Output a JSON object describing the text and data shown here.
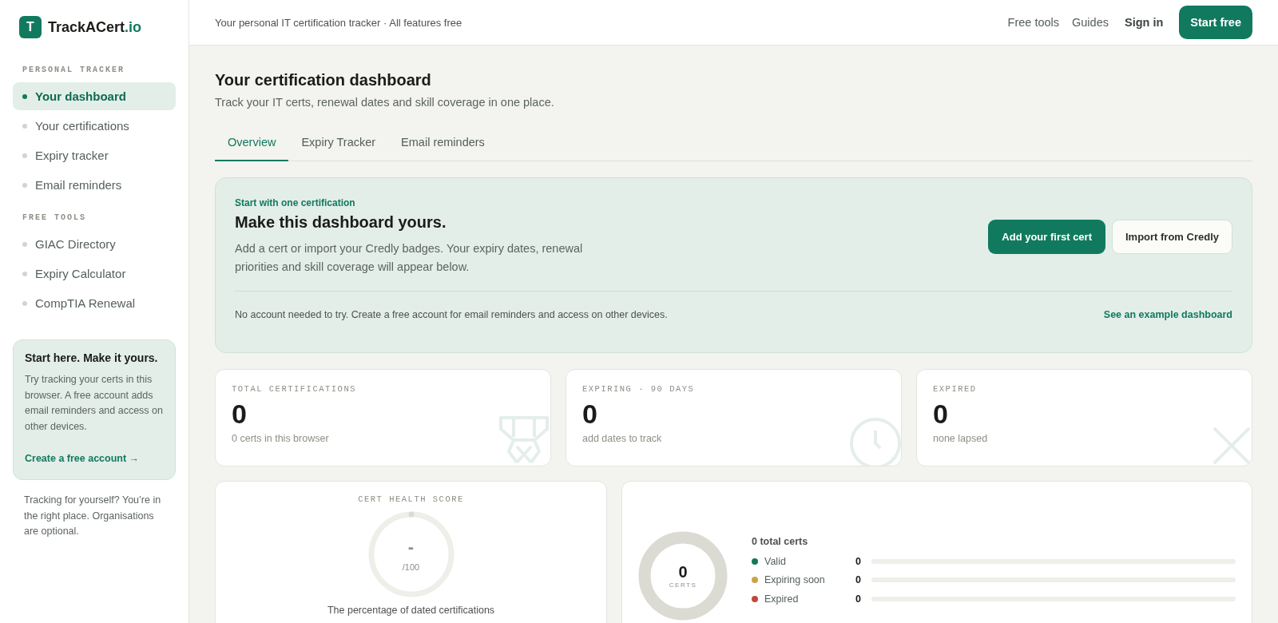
{
  "brand": {
    "logo_letter": "T",
    "name": "TrackACert",
    "suffix": ".io"
  },
  "sidebar": {
    "sections": [
      {
        "heading": "PERSONAL TRACKER",
        "items": [
          {
            "label": "Your dashboard",
            "selected": true
          },
          {
            "label": "Your certifications",
            "selected": false
          },
          {
            "label": "Expiry tracker",
            "selected": false
          },
          {
            "label": "Email reminders",
            "selected": false
          }
        ]
      },
      {
        "heading": "FREE TOOLS",
        "items": [
          {
            "label": "GIAC Directory",
            "selected": false
          },
          {
            "label": "Expiry Calculator",
            "selected": false
          },
          {
            "label": "CompTIA Renewal",
            "selected": false
          }
        ]
      }
    ],
    "promo": {
      "title": "Start here. Make it yours.",
      "text": "Try tracking your certs in this browser. A free account adds email reminders and access on other devices.",
      "link": "Create a free account →"
    },
    "note": "Tracking for yourself? You’re in the right place. Organisations are optional."
  },
  "topbar": {
    "tagline": "Your personal IT certification tracker · All features free",
    "links": [
      "Free tools",
      "Guides"
    ],
    "sign_in": "Sign in",
    "cta": "Start free"
  },
  "page": {
    "title": "Your certification dashboard",
    "subtitle": "Track your IT certs, renewal dates and skill coverage in one place."
  },
  "tabs": [
    {
      "label": "Overview",
      "selected": true
    },
    {
      "label": "Expiry Tracker",
      "selected": false
    },
    {
      "label": "Email reminders",
      "selected": false
    }
  ],
  "hero": {
    "eyebrow": "Start with one certification",
    "title": "Make this dashboard yours.",
    "text": "Add a cert or import your Credly badges. Your expiry dates, renewal priorities and skill coverage will appear below.",
    "primary": "Add your first cert",
    "secondary": "Import from Credly",
    "footnote": "No account needed to try. Create a free account for email reminders and access on other devices.",
    "footlink": "See an example dashboard"
  },
  "stats": [
    {
      "kind": "total",
      "label": "TOTAL CERTIFICATIONS",
      "value": "0",
      "caption": "0 certs in this browser"
    },
    {
      "kind": "expiring",
      "label": "EXPIRING · 90 DAYS",
      "value": "0",
      "caption": "add dates to track"
    },
    {
      "kind": "expired",
      "label": "EXPIRED",
      "value": "0",
      "caption": "none lapsed"
    }
  ],
  "health": {
    "label": "CERT HEALTH SCORE",
    "score": "-",
    "max": "/100",
    "caption": "The percentage of dated certifications"
  },
  "breakdown": {
    "center_value": "0",
    "center_label": "CERTS",
    "total": "0 total certs",
    "rows": [
      {
        "label": "Valid",
        "count": "0",
        "color": "#117a5e",
        "level": 0
      },
      {
        "label": "Expiring soon",
        "count": "0",
        "color": "#c9a448",
        "level": 0
      },
      {
        "label": "Expired",
        "count": "0",
        "color": "#bf4a3c",
        "level": 0
      }
    ]
  }
}
